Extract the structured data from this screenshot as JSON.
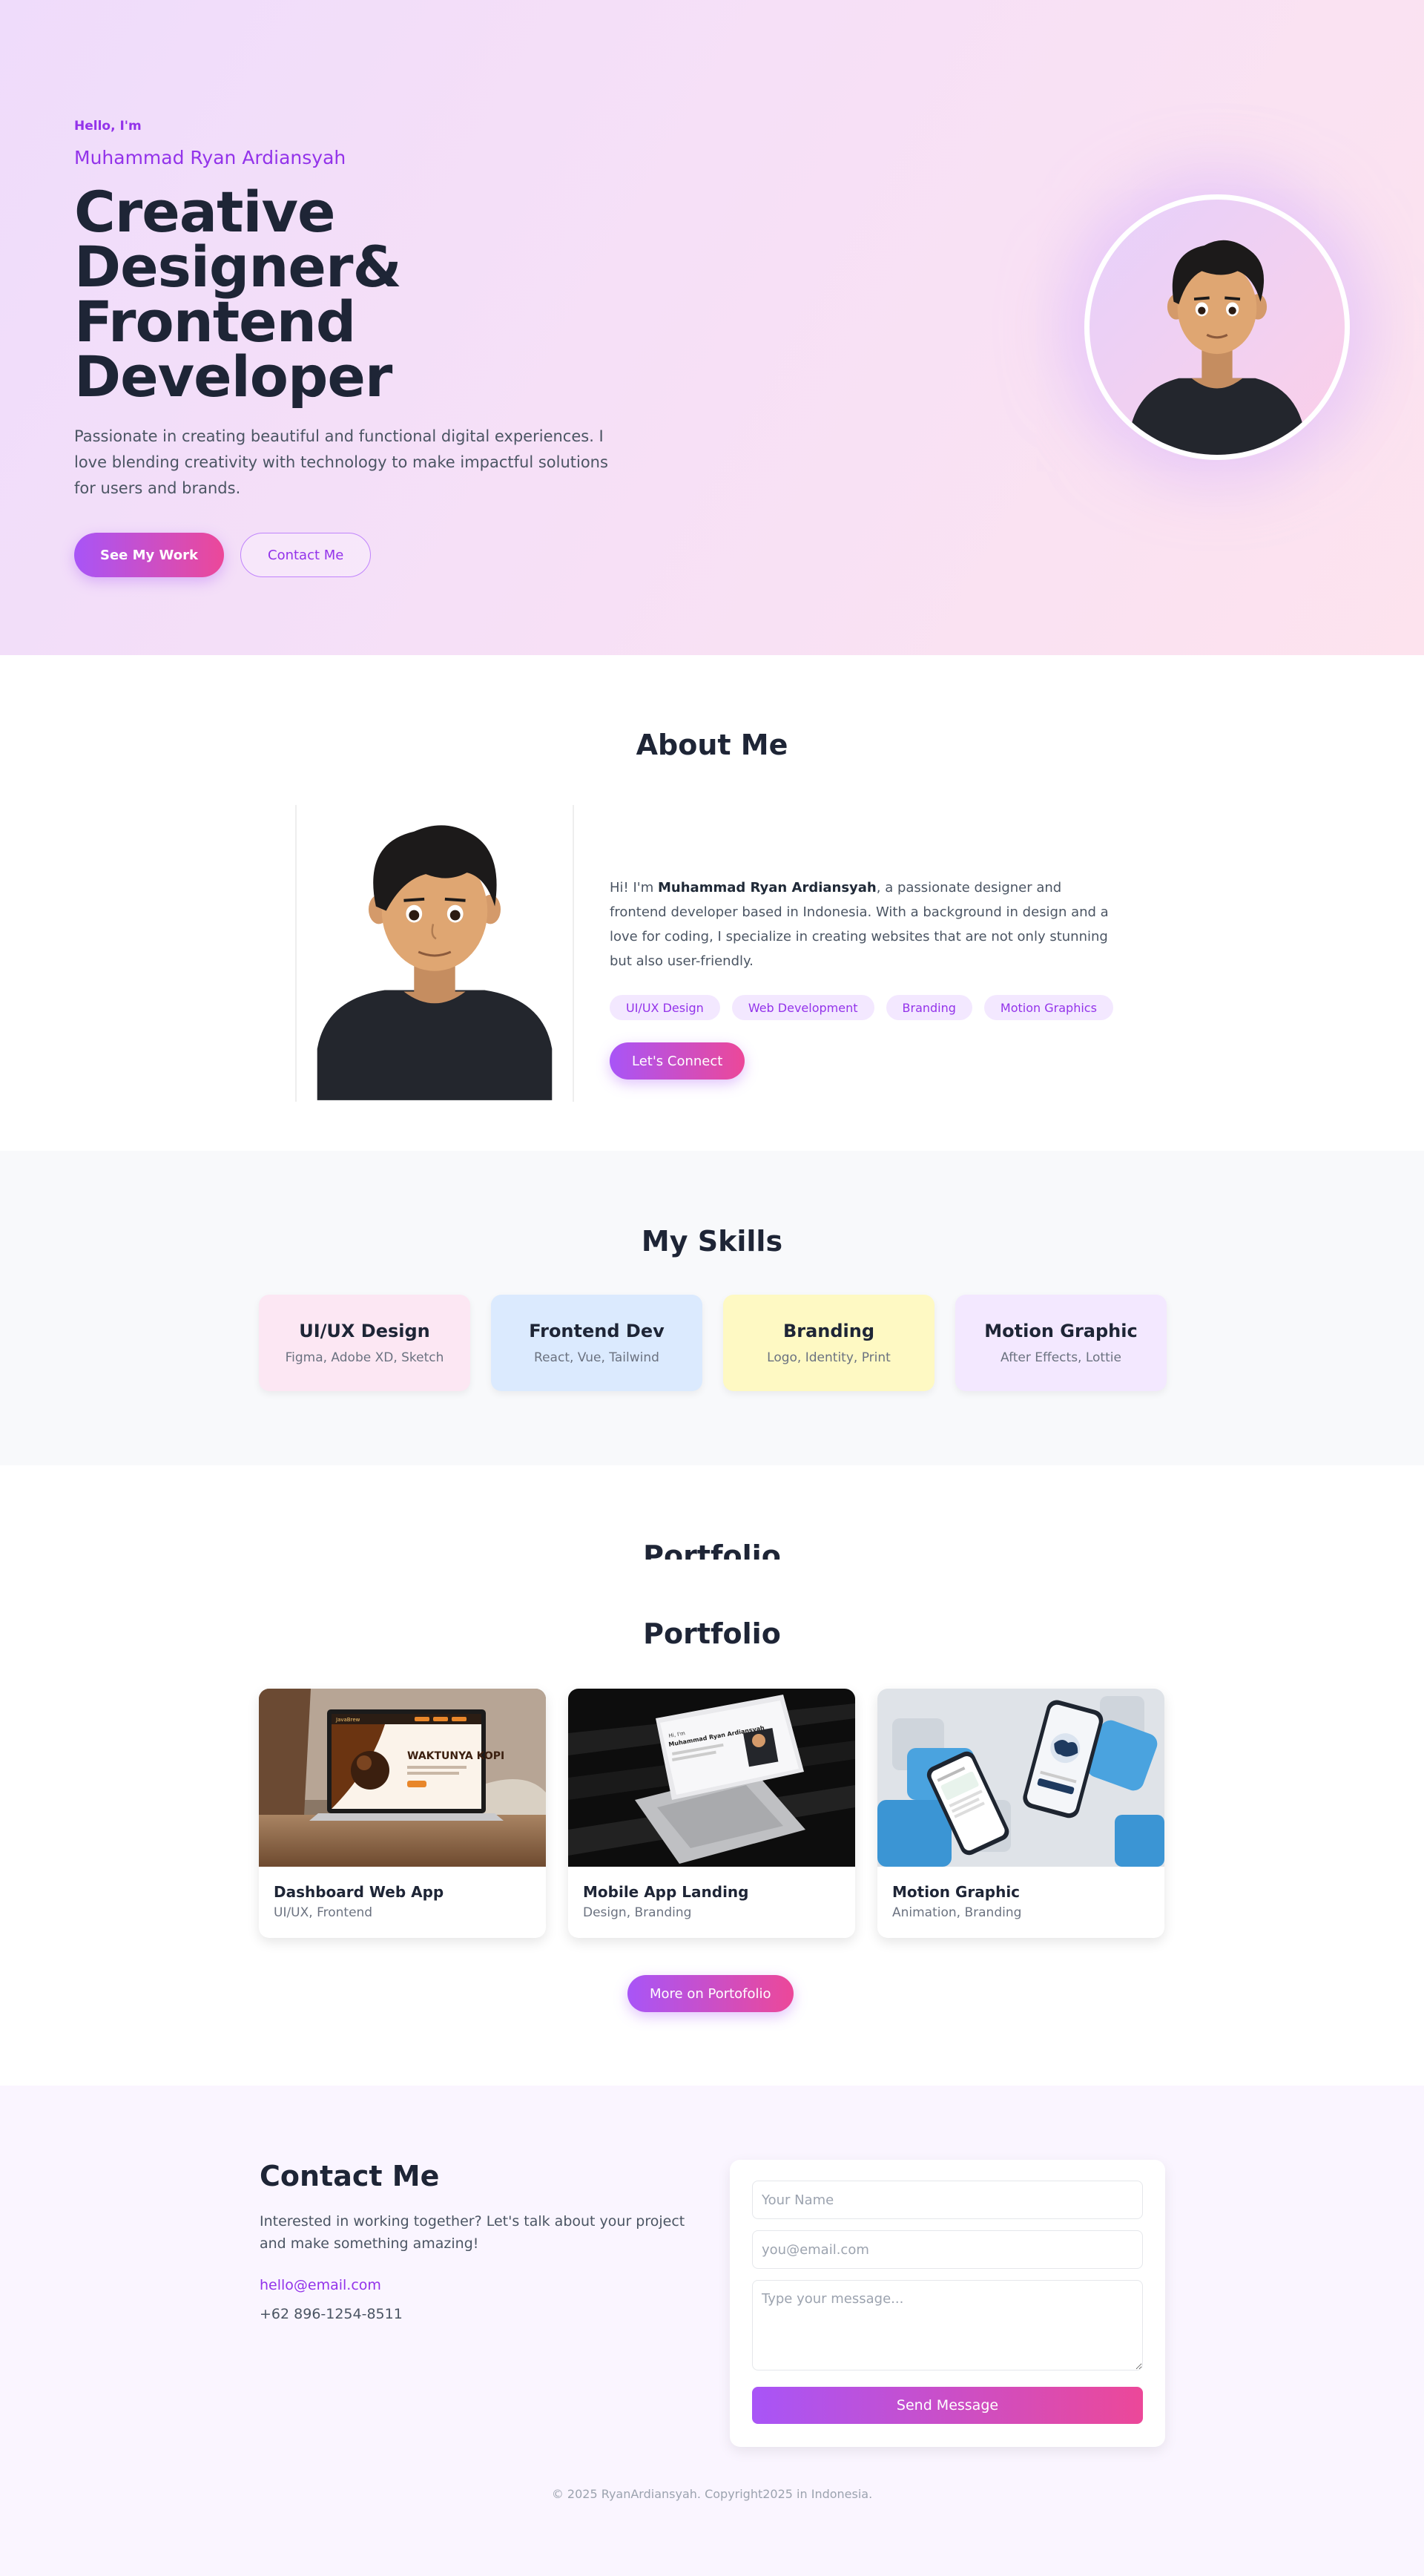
{
  "hero": {
    "greeting": "Hello, I'm",
    "name": "Muhammad Ryan Ardiansyah",
    "title_line1": "Creative Designer&",
    "title_line2": "Frontend",
    "title_line3": "Developer",
    "description": "Passionate in creating beautiful and functional digital experiences. I love blending creativity with technology to make impactful solutions for users and brands.",
    "primary_button": "See My Work",
    "secondary_button": "Contact Me"
  },
  "about": {
    "title": "About Me",
    "intro_prefix": "Hi! I'm ",
    "intro_name": "Muhammad Ryan Ardiansyah",
    "intro_rest": ", a passionate designer and frontend developer based in Indonesia. With a background in design and a love for coding, I specialize in creating websites that are not only stunning but also user-friendly.",
    "tags": [
      "UI/UX Design",
      "Web Development",
      "Branding",
      "Motion Graphics"
    ],
    "connect_button": "Let's Connect"
  },
  "skills": {
    "title": "My Skills",
    "items": [
      {
        "name": "UI/UX Design",
        "tools": "Figma, Adobe XD, Sketch",
        "color": "#fce7f3"
      },
      {
        "name": "Frontend Dev",
        "tools": "React, Vue, Tailwind",
        "color": "#dbeafe"
      },
      {
        "name": "Branding",
        "tools": "Logo, Identity, Print",
        "color": "#fef9c3"
      },
      {
        "name": "Motion Graphic",
        "tools": "After Effects, Lottie",
        "color": "#f3e8ff"
      }
    ]
  },
  "portfolio": {
    "ghost_title": "Portfolio",
    "title": "Portfolio",
    "projects": [
      {
        "name": "Dashboard Web App",
        "category": "UI/UX, Frontend"
      },
      {
        "name": "Mobile App Landing",
        "category": "Design, Branding"
      },
      {
        "name": "Motion Graphic",
        "category": "Animation, Branding"
      }
    ],
    "thumb_text": {
      "coffee_headline": "WAKTUNYA KOPI",
      "coffee_brand": "JavaBrew",
      "laptop_greeting": "Hi, I'm",
      "laptop_name": "Muhammad Ryan Ardiansyah"
    },
    "more_button": "More on Portofolio"
  },
  "contact": {
    "title": "Contact Me",
    "description": "Interested in working together? Let's talk about your project and make something amazing!",
    "email": "hello@email.com",
    "phone": "+62 896-1254-8511",
    "form": {
      "name_placeholder": "Your Name",
      "email_placeholder": "you@email.com",
      "message_placeholder": "Type your message...",
      "send_button": "Send Message"
    }
  },
  "footer": {
    "text": "© 2025 RyanArdiansyah. Copyright2025 in Indonesia."
  },
  "colors": {
    "accent": "#9333ea",
    "gradient_start": "#a855f7",
    "gradient_end": "#ec4899",
    "heading": "#1e2536"
  }
}
